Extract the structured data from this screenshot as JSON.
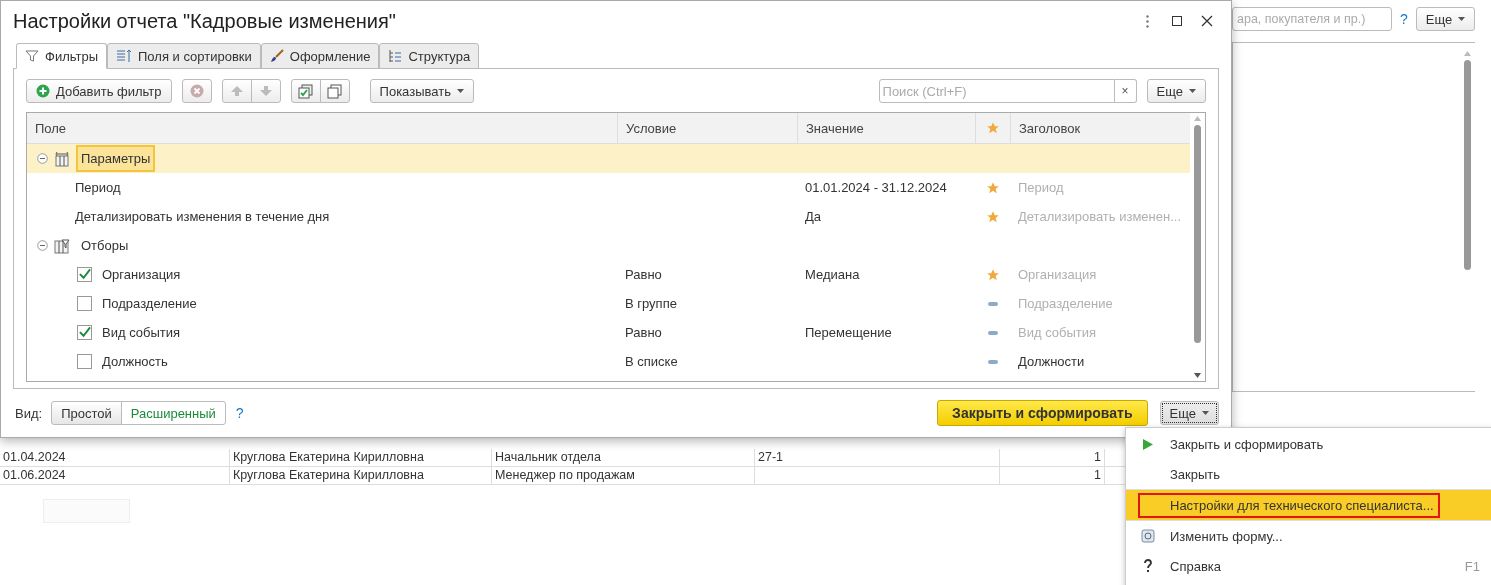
{
  "window": {
    "title": "Настройки отчета \"Кадровые изменения\""
  },
  "tabs": [
    {
      "label": "Фильтры",
      "kind": "filter",
      "selected": true
    },
    {
      "label": "Поля и сортировки",
      "kind": "fields",
      "selected": false
    },
    {
      "label": "Оформление",
      "kind": "brush",
      "selected": false
    },
    {
      "label": "Структура",
      "kind": "structure",
      "selected": false
    }
  ],
  "toolbar": {
    "add_button": "Добавить фильтр",
    "show_button": "Показывать",
    "search": {
      "placeholder": "Поиск (Ctrl+F)"
    },
    "clear_button": "×",
    "more_button": "Еще"
  },
  "table": {
    "columns": [
      "Поле",
      "Условие",
      "Значение",
      "Заголовок"
    ],
    "groups": [
      {
        "label": "Параметры",
        "kind": "parameters",
        "selected": true,
        "expanded": true,
        "children": [
          {
            "field": "Период",
            "value": "01.01.2024 - 31.12.2024",
            "quick": true,
            "title": "Период",
            "title_custom": false
          },
          {
            "field": "Детализировать изменения в течение дня",
            "value": "Да",
            "quick": true,
            "title": "Детализировать изменен...",
            "title_custom": false
          }
        ]
      },
      {
        "label": "Отборы",
        "kind": "filters",
        "selected": false,
        "expanded": true,
        "children": [
          {
            "field": "Организация",
            "checked": true,
            "condition": "Равно",
            "value": "Медиана",
            "quick": true,
            "title": "Организация",
            "title_custom": false
          },
          {
            "field": "Подразделение",
            "checked": false,
            "condition": "В группе",
            "quick": false,
            "title": "Подразделение",
            "title_custom": false
          },
          {
            "field": "Вид события",
            "checked": true,
            "condition": "Равно",
            "value": "Перемещение",
            "quick": false,
            "title": "Вид события",
            "title_custom": false
          },
          {
            "field": "Должность",
            "checked": false,
            "condition": "В списке",
            "quick": false,
            "title": "Должности",
            "title_custom": true
          }
        ]
      }
    ]
  },
  "view": {
    "label": "Вид:",
    "options": [
      {
        "label": "Простой",
        "selected": false
      },
      {
        "label": "Расширенный",
        "selected": true
      }
    ],
    "help": "?"
  },
  "footer": {
    "primary_button": "Закрыть и сформировать",
    "more_button": "Еще"
  },
  "background": {
    "search": {
      "placeholder": "ара, покупателя и пр.)"
    },
    "help": "?",
    "more_button": "Еще",
    "report_rows": [
      [
        "01.04.2024",
        "Круглова Екатерина Кирилловна",
        "Начальник отдела",
        "27-1",
        "1"
      ],
      [
        "01.06.2024",
        "Круглова Екатерина Кирилловна",
        "Менеджер по продажам",
        "",
        "1"
      ]
    ]
  },
  "menu": {
    "items": [
      {
        "label": "Закрыть и сформировать",
        "kind": "play",
        "selected": false
      },
      {
        "label": "Закрыть",
        "selected": false
      },
      {
        "label": "Настройки для технического специалиста...",
        "selected": true
      },
      {
        "label": "Изменить форму...",
        "kind": "form",
        "selected": false
      },
      {
        "label": "Справка",
        "kind": "help",
        "shortcut": "F1",
        "selected": false
      }
    ]
  }
}
